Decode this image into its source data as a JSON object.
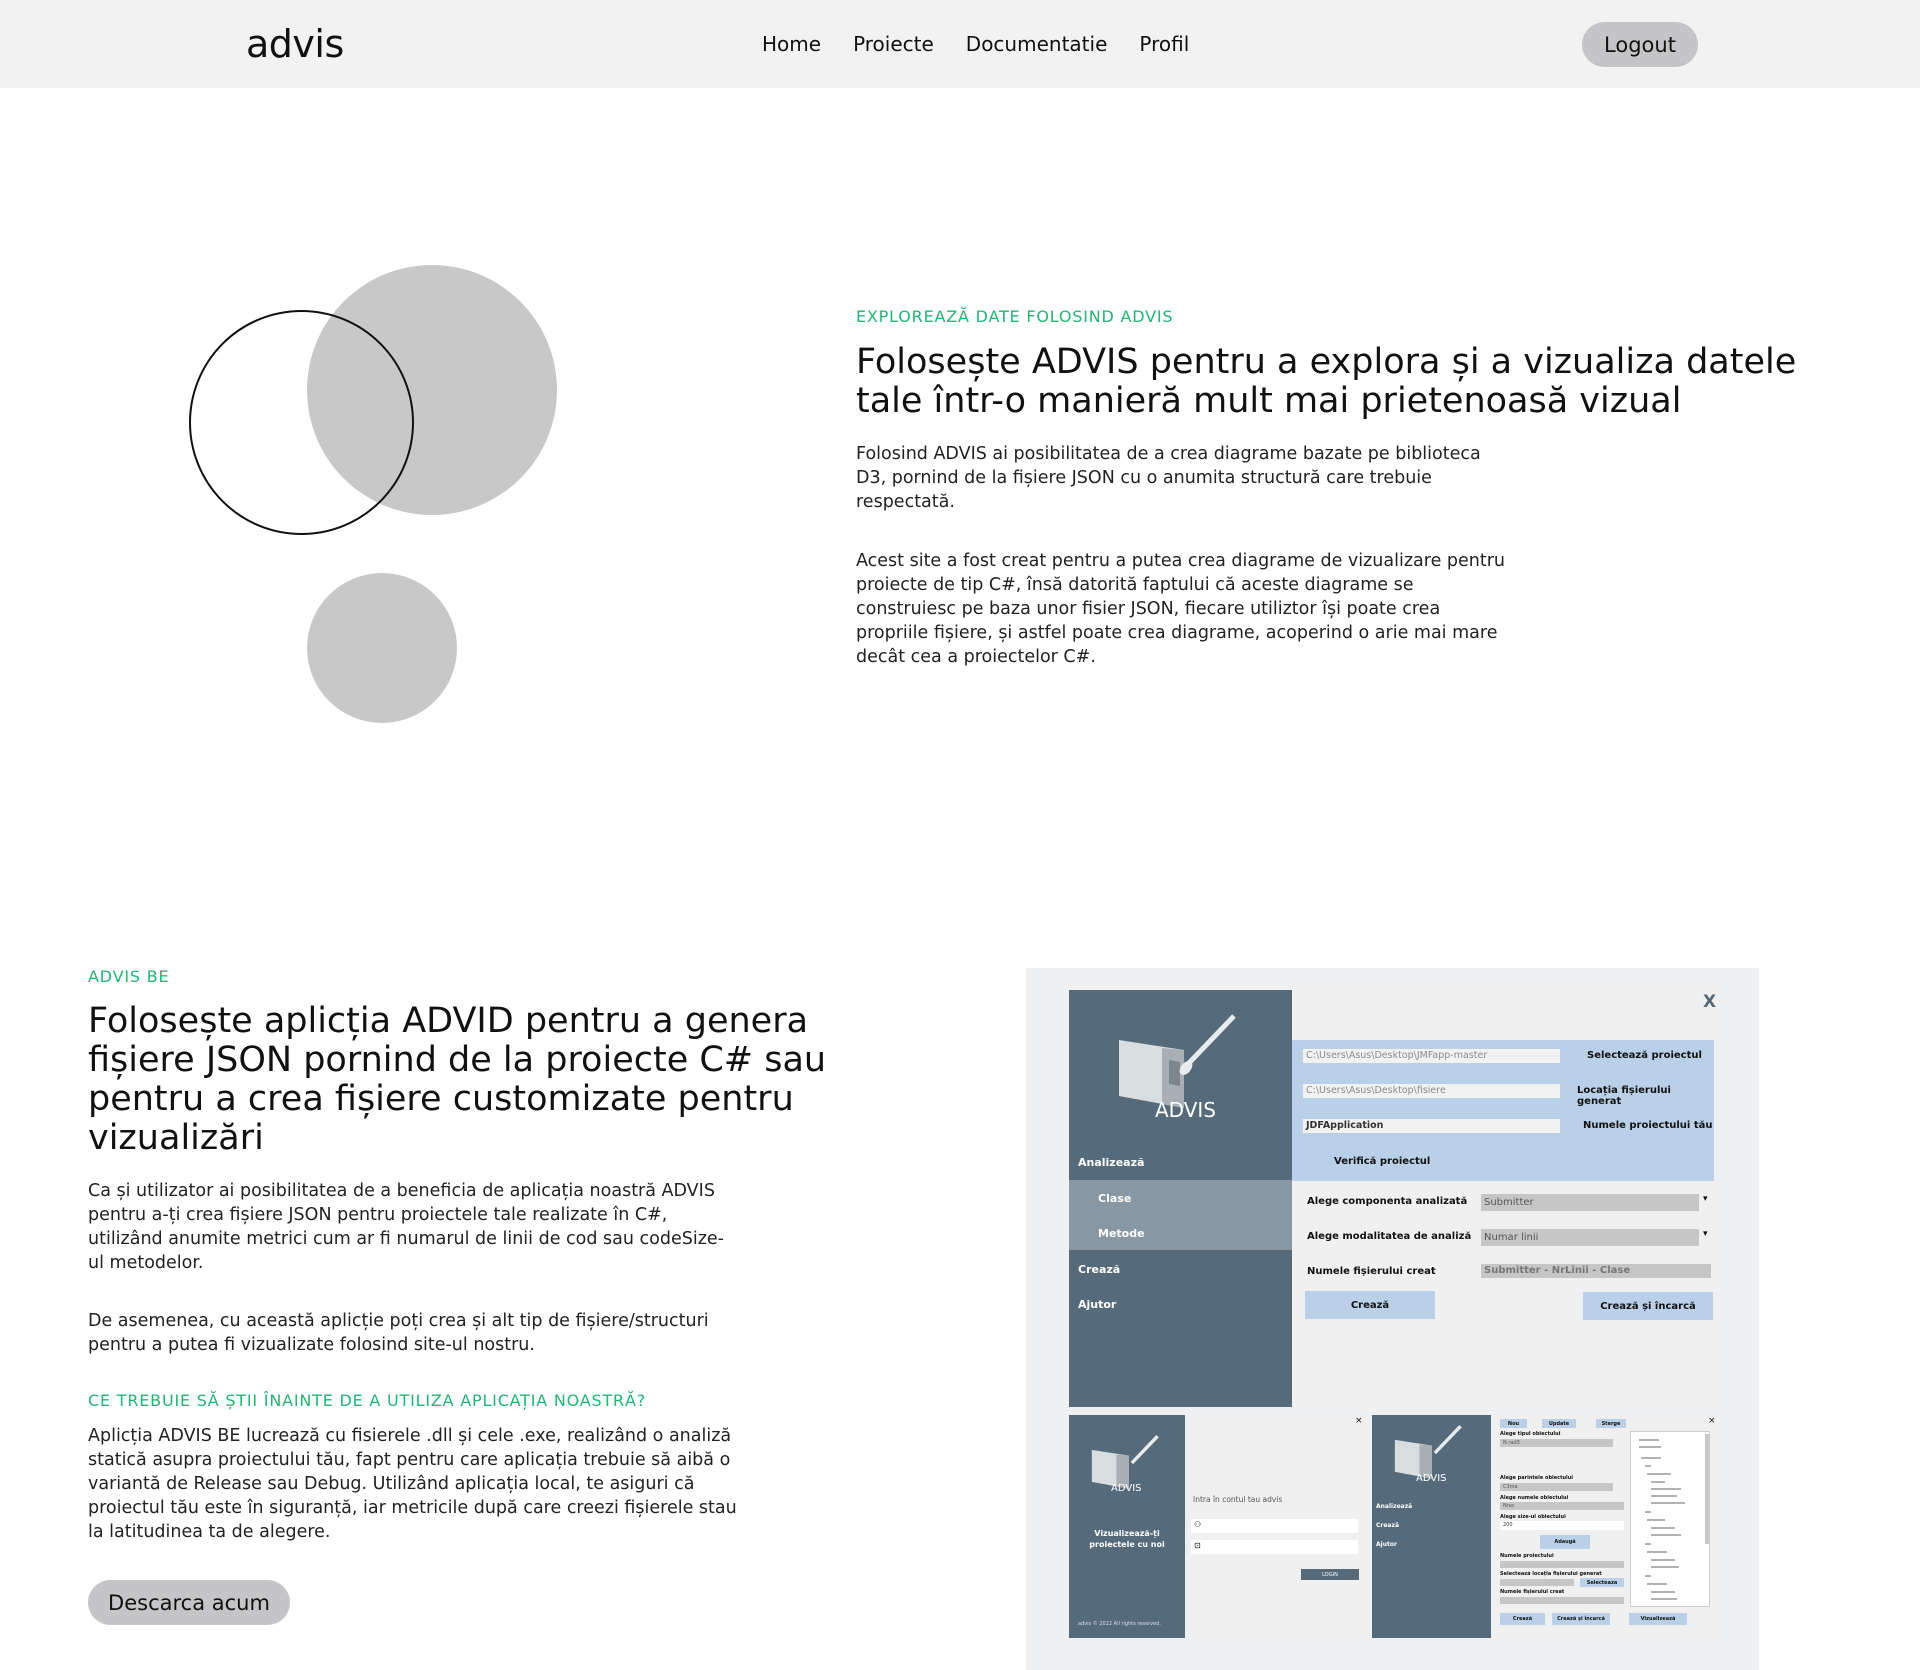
{
  "nav": {
    "logo": "advis",
    "links": [
      "Home",
      "Proiecte",
      "Documentatie",
      "Profil"
    ],
    "logout": "Logout"
  },
  "hero": {
    "eyebrow": "EXPLOREAZĂ DATE FOLOSIND ADVIS",
    "title": "Folosește ADVIS pentru a explora și a vizualiza datele tale într-o manieră mult mai prietenoasă vizual",
    "p1": "Folosind ADVIS ai posibilitatea de a crea diagrame bazate pe biblioteca D3, pornind de la fișiere JSON cu o anumita structură care trebuie respectată.",
    "p2": "Acest site a fost creat pentru a putea crea diagrame de vizualizare pentru proiecte de tip C#, însă datorită faptului că aceste diagrame se construiesc pe baza unor fisier JSON, fiecare utiliztor își poate crea propriile fișiere, și astfel poate crea diagrame, acoperind o arie mai mare decât cea a proiectelor C#."
  },
  "be": {
    "eyebrow": "ADVIS BE",
    "title": "Folosește aplicția ADVID pentru a genera fișiere JSON pornind de la proiecte C# sau pentru a crea fișiere customizate pentru vizualizări",
    "p1": "Ca și utilizator ai posibilitatea de a beneficia de aplicația noastră ADVIS pentru a-ți crea fișiere JSON pentru proiectele tale realizate în C#, utilizând anumite metrici cum ar fi numarul de linii de cod sau codeSize-ul metodelor.",
    "p2": "De asemenea, cu această aplicție poți crea și alt tip de fișiere/structuri pentru a putea fi vizualizate folosind site-ul nostru.",
    "eyebrow2": "CE TREBUIE SĂ ȘTII ÎNAINTE DE A UTILIZA APLICAȚIA NOASTRĂ?",
    "p3": "Aplicția ADVIS BE lucrează cu fisierele .dll și cele .exe, realizând o analiză statică asupra proiectului tău, fapt pentru care aplicația trebuie să aibă o variantă de Release sau Debug. Utilizând aplicația local, te asiguri că proiectul tău este în siguranță, iar metricile după care creezi fișierele stau la latitudinea ta de alegere.",
    "download": "Descarca acum"
  },
  "app": {
    "close": "X",
    "brand": "ADVIS",
    "menu": {
      "analyze": "Analizează",
      "classes": "Clase",
      "methods": "Metode",
      "create": "Crează",
      "help": "Ajutor"
    },
    "path1": "C:\\Users\\Asus\\Desktop\\JMFapp-master",
    "path2": "C:\\Users\\Asus\\Desktop\\fisiere",
    "project": "JDFApplication",
    "select_project": "Selectează proiectul",
    "output_location": "Locația fișierului generat",
    "project_name": "Numele proiectului tău",
    "verify": "Verifică proiectul",
    "component_label": "Alege componenta analizată",
    "component_value": "Submitter",
    "mode_label": "Alege modalitatea de analiză",
    "mode_value": "Numar linii",
    "filename_label": "Numele fișierului creat",
    "filename_value": "Submitter - NrLinii - Clase",
    "create": "Crează",
    "create_upload": "Crează și încarcă",
    "login_prompt": "Intra în contul tau advis",
    "login_btn": "LOGIN",
    "tagline": "Vizualizează-ți proiectele cu noi",
    "copyright": "advis © 2022 All rights reserved.",
    "top_btns": [
      "Nou",
      "Update",
      "Sterge"
    ],
    "side2": [
      "Analizează",
      "Crează",
      "Ajutor"
    ],
    "form_labels": [
      "Alege tipul obiectului",
      "Alege parintele obiectului",
      "Alege numele obiectului",
      "Alege size-ul obiectului",
      "Numele proiectului",
      "Selectează locația fișierului generat",
      "Numele fișierului creat"
    ],
    "form_values": [
      "N.rad3",
      "C3ma",
      "Nrac",
      "200"
    ],
    "add_btn": "Adaugă",
    "select_btn": "Selecteaza",
    "bottom_btns": [
      "Crează",
      "Crează și încarcă",
      "Vizualizează"
    ]
  }
}
